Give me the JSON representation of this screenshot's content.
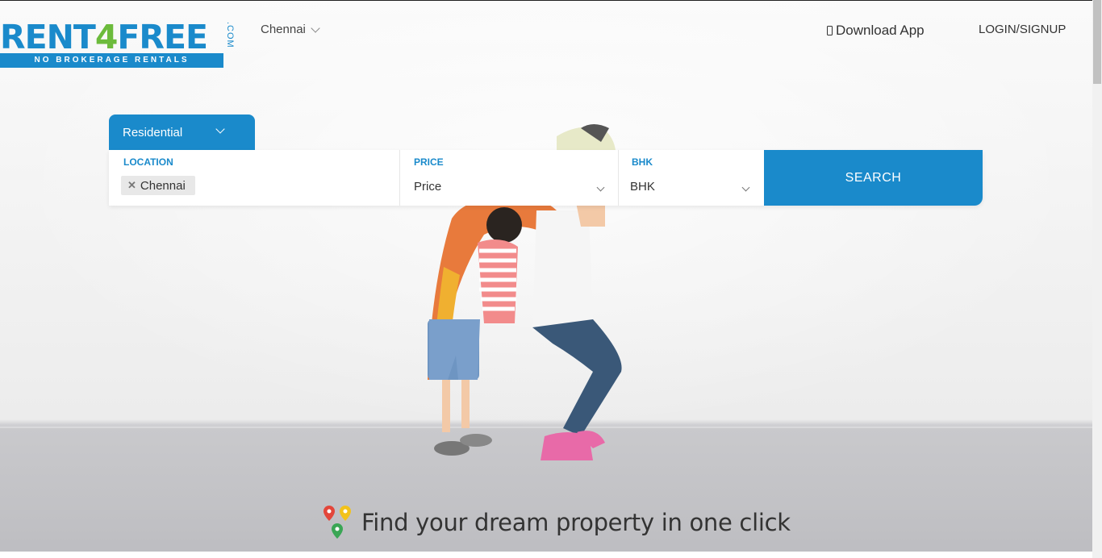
{
  "header": {
    "logo_text_main": "RENT",
    "logo_text_four": "4",
    "logo_text_end": "FREE",
    "logo_com": ".COM",
    "logo_tagline": "NO BROKERAGE RENTALS",
    "city": "Chennai",
    "download_app": "Download App",
    "login": "LOGIN/SIGNUP"
  },
  "search": {
    "property_type": "Residential",
    "location_label": "LOCATION",
    "location_chip": "Chennai",
    "price_label": "PRICE",
    "price_value": "Price",
    "bhk_label": "BHK",
    "bhk_value": "BHK",
    "search_button": "SEARCH"
  },
  "tagline": "Find your dream property in one click",
  "colors": {
    "brand_blue": "#1a8acb",
    "brand_green": "#6cbb3c"
  },
  "icons": [
    "phone-icon",
    "chevron-down-icon",
    "close-icon",
    "map-pin-icon"
  ]
}
